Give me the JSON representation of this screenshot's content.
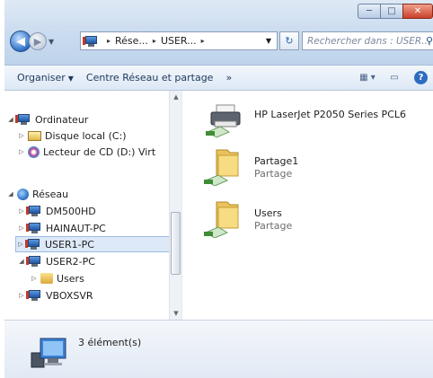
{
  "window": {
    "controls": {
      "minimize": "─",
      "maximize": "□",
      "close": "✕"
    }
  },
  "address_bar": {
    "crumbs": [
      "Rése...",
      "USER..."
    ],
    "separator": "▸",
    "search_placeholder": "Rechercher dans : USER..."
  },
  "toolbar": {
    "organise_label": "Organiser",
    "network_center_label": "Centre Réseau et partage",
    "more_label": "»"
  },
  "nav_tree": {
    "items": [
      {
        "label": "Ordinateur",
        "icon": "computer-icon"
      },
      {
        "label": "Disque local (C:)",
        "icon": "drive-icon"
      },
      {
        "label": "Lecteur de CD (D:) Virt",
        "icon": "cd-drive-icon"
      },
      {
        "label": "Réseau",
        "icon": "network-icon"
      },
      {
        "label": "DM500HD",
        "icon": "computer-icon"
      },
      {
        "label": "HAINAUT-PC",
        "icon": "computer-icon"
      },
      {
        "label": "USER1-PC",
        "icon": "computer-icon",
        "selected": true
      },
      {
        "label": "USER2-PC",
        "icon": "computer-icon"
      },
      {
        "label": "Users",
        "icon": "user-folder-icon"
      },
      {
        "label": "VBOXSVR",
        "icon": "computer-icon"
      }
    ]
  },
  "content": {
    "items": [
      {
        "name": "HP LaserJet P2050 Series PCL6",
        "type": "",
        "icon": "printer-icon"
      },
      {
        "name": "Partage1",
        "type": "Partage",
        "icon": "shared-folder-icon"
      },
      {
        "name": "Users",
        "type": "Partage",
        "icon": "shared-folder-icon"
      }
    ]
  },
  "status": {
    "count": "3 élément(s)"
  }
}
